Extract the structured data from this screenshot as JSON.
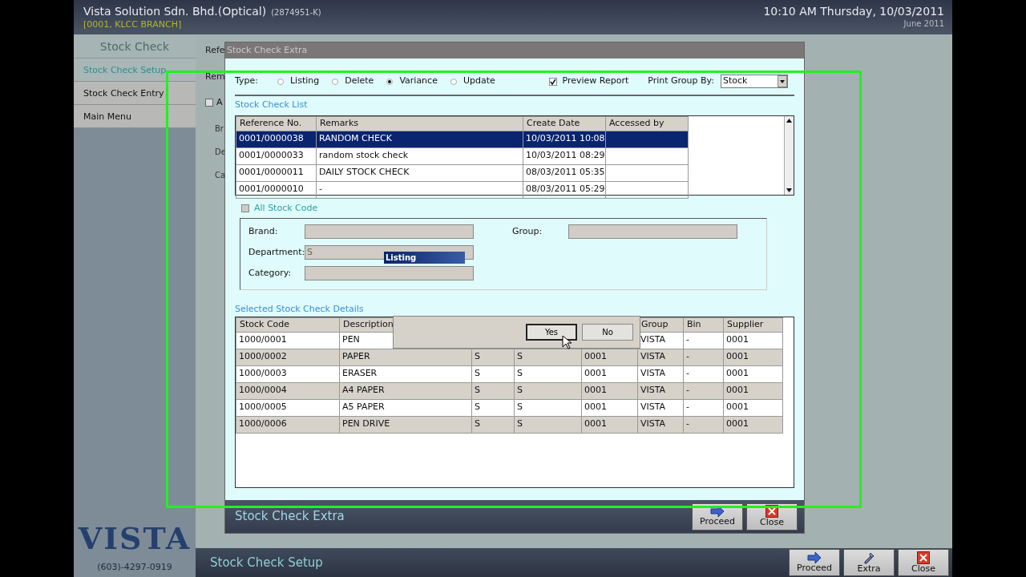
{
  "header": {
    "company": "Vista Solution Sdn. Bhd.(Optical)",
    "reg_no": "(2874951-K)",
    "branch": "[0001, KLCC BRANCH]",
    "clock": "10:10 AM  Thursday, 10/03/2011",
    "version": "June 2011"
  },
  "sidebar": {
    "title": "Stock Check",
    "items": [
      {
        "label": "Stock Check Setup",
        "selected": true
      },
      {
        "label": "Stock Check Entry",
        "selected": false
      },
      {
        "label": "Main Menu",
        "selected": false
      }
    ],
    "logo": "VISTA",
    "phone": "(603)-4297-0919"
  },
  "background_window": {
    "labels": [
      "Refe",
      "Rem"
    ],
    "checkbox": {
      "label": "A",
      "checked": false
    },
    "side_labels": [
      "Br",
      "De",
      "Ca"
    ],
    "footer_title": "Stock Check Setup",
    "buttons": [
      {
        "label": "Proceed",
        "kind": "proceed"
      },
      {
        "label": "Extra",
        "kind": "extra"
      },
      {
        "label": "Close",
        "kind": "close"
      }
    ]
  },
  "dialog": {
    "title": "Stock Check Extra",
    "type_label": "Type:",
    "types": [
      {
        "label": "Listing",
        "selected": false
      },
      {
        "label": "Delete",
        "selected": false
      },
      {
        "label": "Variance",
        "selected": true
      },
      {
        "label": "Update",
        "selected": false
      }
    ],
    "preview": {
      "label": "Preview Report",
      "checked": true
    },
    "print_group": {
      "label": "Print Group By:",
      "value": "Stock"
    },
    "list": {
      "title": "Stock Check List",
      "columns": [
        "Reference No.",
        "Remarks",
        "Create Date",
        "Accessed by"
      ],
      "rows": [
        {
          "cells": [
            "0001/0000038",
            "RANDOM CHECK",
            "10/03/2011 10:08",
            null
          ],
          "selected": true
        },
        {
          "cells": [
            "0001/0000033",
            "random stock check",
            "10/03/2011 08:29",
            null
          ],
          "selected": false
        },
        {
          "cells": [
            "0001/0000011",
            "DAILY STOCK CHECK",
            "08/03/2011 05:35",
            null
          ],
          "selected": false
        },
        {
          "cells": [
            "0001/0000010",
            "-",
            "08/03/2011 05:29",
            null
          ],
          "selected": false
        }
      ]
    },
    "all_stock": {
      "label": "All Stock Code",
      "checked": false
    },
    "filters_left": [
      {
        "label": "Brand:"
      },
      {
        "label": "Department:",
        "value": "S"
      },
      {
        "label": "Category:"
      }
    ],
    "filters_right": [
      {
        "label": "Group:"
      }
    ],
    "fragment": "Listing",
    "details": {
      "title": "Selected Stock Check Details",
      "columns": [
        "Stock Code",
        "Description",
        null,
        null,
        null,
        "Group",
        "Bin",
        "Supplier"
      ],
      "rows": [
        {
          "cells": [
            "1000/0001",
            "PEN",
            null,
            null,
            null,
            "VISTA",
            "-",
            "0001"
          ]
        },
        {
          "cells": [
            "1000/0002",
            "PAPER",
            "S",
            "S",
            "0001",
            "VISTA",
            "-",
            "0001"
          ]
        },
        {
          "cells": [
            "1000/0003",
            "ERASER",
            "S",
            "S",
            "0001",
            "VISTA",
            "-",
            "0001"
          ]
        },
        {
          "cells": [
            "1000/0004",
            "A4 PAPER",
            "S",
            "S",
            "0001",
            "VISTA",
            "-",
            "0001"
          ]
        },
        {
          "cells": [
            "1000/0005",
            "A5 PAPER",
            "S",
            "S",
            "0001",
            "VISTA",
            "-",
            "0001"
          ]
        },
        {
          "cells": [
            "1000/0006",
            "PEN DRIVE",
            "S",
            "S",
            "0001",
            "VISTA",
            "-",
            "0001"
          ]
        }
      ]
    },
    "confirm": {
      "buttons": [
        {
          "label": "Yes",
          "selected": true
        },
        {
          "label": "No",
          "selected": false
        }
      ]
    },
    "footer_title": "Stock Check Extra",
    "buttons": [
      {
        "label": "Proceed",
        "kind": "proceed"
      },
      {
        "label": "Close",
        "kind": "close"
      }
    ]
  }
}
